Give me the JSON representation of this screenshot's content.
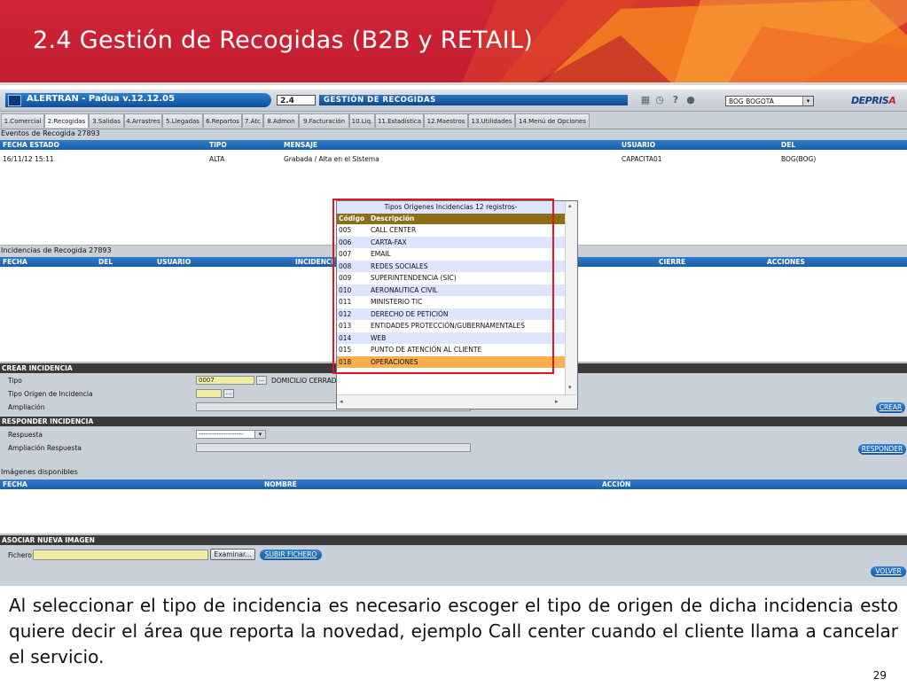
{
  "slide": {
    "title": "2.4 Gestión de Recogidas (B2B y RETAIL)",
    "caption": "Al seleccionar el tipo de incidencia es necesario escoger el tipo de origen de dicha incidencia esto quiere decir el área que reporta la novedad, ejemplo Call center cuando el cliente llama a cancelar el servicio.",
    "page_number": "29",
    "colors": {
      "header_red": "#c8202f",
      "accent_orange": "#f5821f"
    }
  },
  "app": {
    "name": "ALERTRAN - Padua  v.12.12.05",
    "screen_code": "2.4",
    "screen_title": "GESTIÓN DE RECOGIDAS",
    "city": "BOG BOGOTA",
    "brand_main": "DEPRIS",
    "brand_accent": "A",
    "icons": [
      "calendar-icon",
      "clock-icon",
      "help-icon",
      "user-icon"
    ],
    "tabs": [
      "1.Comercial",
      "2.Recogidas",
      "3.Salidas",
      "4.Arrastres",
      "5.Llegadas",
      "6.Repartos",
      "7.Atc",
      "8.Admon",
      "9.Facturación",
      "10.Liq.",
      "11.Estadística",
      "12.Maestros",
      "13.Utilidades",
      "14.Menú de Opciones"
    ]
  },
  "eventos": {
    "label": "Eventos de Recogida 27893",
    "columns": [
      "FECHA ESTADO",
      "TIPO",
      "MENSAJE",
      "USUARIO",
      "DEL"
    ],
    "row": [
      "16/11/12 15:11",
      "ALTA",
      "Grabada / Alta en el Sistema",
      "CAPACITA01",
      "BOG(BOG)"
    ]
  },
  "incidencias": {
    "label": "Incidencias de Recogida 27893",
    "columns": [
      "FECHA",
      "DEL",
      "USUARIO",
      "INCIDENCI",
      "CIERRE",
      "ACCIONES"
    ]
  },
  "crear": {
    "header": "CREAR INCIDENCIA",
    "tipo_label": "Tipo",
    "tipo_value": "0007",
    "tipo_desc": "DOMICILIO CERRAD",
    "origen_label": "Tipo Origen de Incidencia",
    "ampliacion_label": "Ampliación",
    "browse": "...",
    "button": "CREAR"
  },
  "responder": {
    "header": "RESPONDER INCIDENCIA",
    "respuesta_label": "Respuesta",
    "respuesta_value": "--------------------",
    "ampliacion_label": "Ampliación Respuesta",
    "button": "RESPONDER"
  },
  "imagenes": {
    "label": "Imágenes disponibles",
    "columns": [
      "FECHA",
      "NOMBRE",
      "ACCIÓN"
    ]
  },
  "asociar": {
    "header": "ASOCIAR NUEVA IMAGEN",
    "fichero_label": "Fichero",
    "examinar": "Examinar...",
    "subir": "SUBIR FICHERO",
    "volver": "VOLVER"
  },
  "popup": {
    "title": "Tipos Origenes Incidencias 12 registros-",
    "col_code": "Código",
    "col_desc": "Descripción",
    "rows": [
      {
        "code": "005",
        "desc": "CALL CENTER"
      },
      {
        "code": "006",
        "desc": "CARTA-FAX"
      },
      {
        "code": "007",
        "desc": "EMAIL"
      },
      {
        "code": "008",
        "desc": "REDES SOCIALES"
      },
      {
        "code": "009",
        "desc": "SUPERINTENDENCIA (SIC)"
      },
      {
        "code": "010",
        "desc": "AERONAUTICA CIVIL"
      },
      {
        "code": "011",
        "desc": "MINISTERIO TIC"
      },
      {
        "code": "012",
        "desc": "DERECHO DE PETICIÓN"
      },
      {
        "code": "013",
        "desc": "ENTIDADES PROTECCIÓN/GUBERNAMENTALES"
      },
      {
        "code": "014",
        "desc": "WEB"
      },
      {
        "code": "015",
        "desc": "PUNTO DE ATENCIÓN AL CLIENTE"
      },
      {
        "code": "018",
        "desc": "OPERACIONES"
      }
    ]
  }
}
